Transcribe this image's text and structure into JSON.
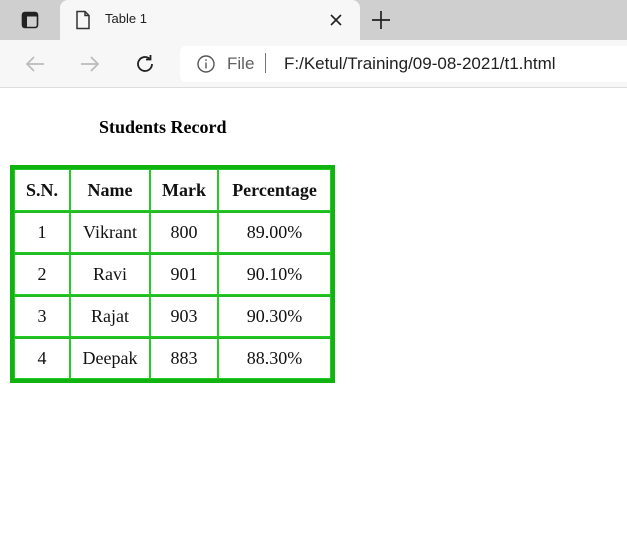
{
  "browser": {
    "tab": {
      "title": "Table 1"
    },
    "address": {
      "scheme": "File",
      "url": "F:/Ketul/Training/09-08-2021/t1.html"
    },
    "icons": {
      "tab_actions": "tab-actions-icon",
      "page": "page-icon",
      "close": "close-icon",
      "new_tab": "plus-icon",
      "back": "arrow-left-icon",
      "forward": "arrow-right-icon",
      "reload": "reload-icon",
      "info": "info-icon"
    }
  },
  "page": {
    "title": "Students Record",
    "table": {
      "headers": [
        "S.N.",
        "Name",
        "Mark",
        "Percentage"
      ],
      "rows": [
        [
          "1",
          "Vikrant",
          "800",
          "89.00%"
        ],
        [
          "2",
          "Ravi",
          "901",
          "90.10%"
        ],
        [
          "3",
          "Rajat",
          "903",
          "90.30%"
        ],
        [
          "4",
          "Deepak",
          "883",
          "88.30%"
        ]
      ],
      "border_color": "#11b311"
    }
  }
}
